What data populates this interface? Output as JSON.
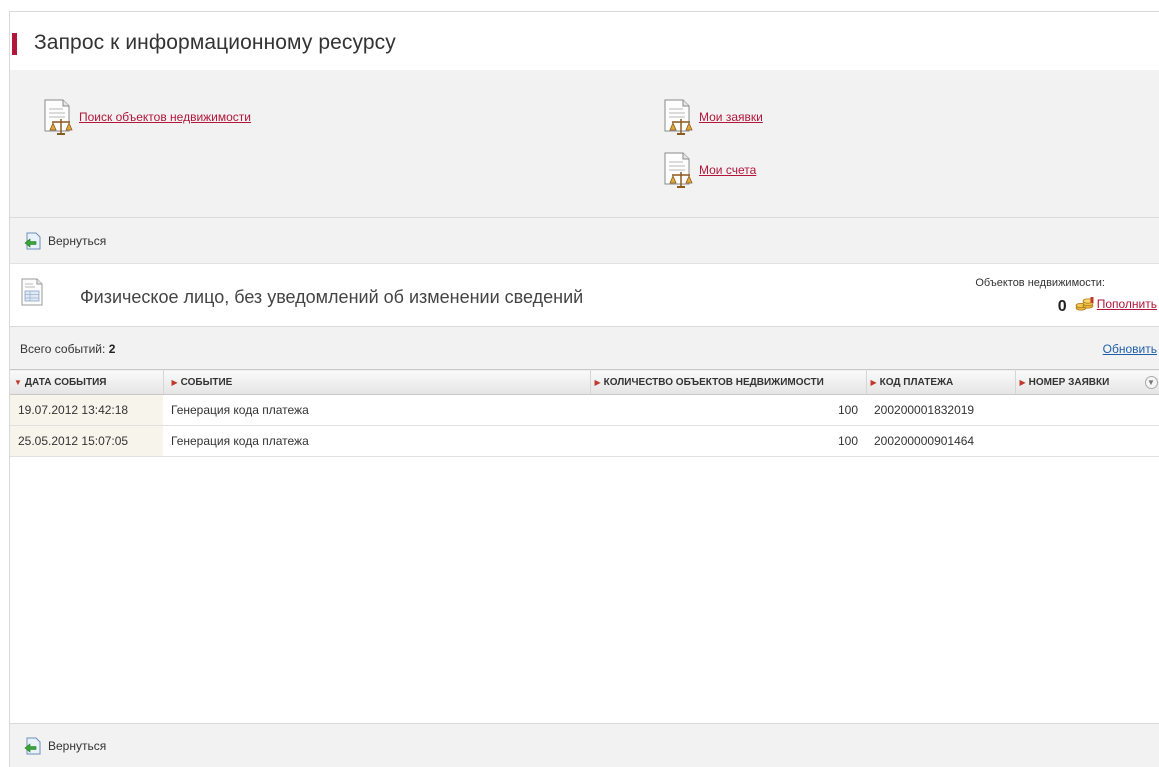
{
  "page": {
    "title": "Запрос к информационному ресурсу",
    "accent_color": "#b2163a",
    "link_color": "#b2163a"
  },
  "links": [
    {
      "label": "Поиск объектов недвижимости",
      "icon": "document-scales-icon"
    },
    {
      "label": "Мои заявки",
      "icon": "document-scales-icon"
    },
    {
      "label": "Мои счета",
      "icon": "document-scales-icon"
    }
  ],
  "toolbar": {
    "back_label": "Вернуться",
    "back_icon": "back-arrow-icon"
  },
  "subject": {
    "title": "Физическое лицо, без уведомлений об изменении сведений",
    "objects_label": "Объектов недвижимости:",
    "objects_count": "0",
    "topup_label": "Пополнить",
    "topup_icon": "coins-icon"
  },
  "summary": {
    "label": "Всего событий:",
    "count": "2",
    "refresh_label": "Обновить",
    "refresh_color": "#1f5fa8"
  },
  "table": {
    "columns": [
      {
        "label": "ДАТА СОБЫТИЯ",
        "sorted": "desc"
      },
      {
        "label": "СОБЫТИЕ",
        "sorted": ""
      },
      {
        "label": "КОЛИЧЕСТВО ОБЪЕКТОВ НЕДВИЖИМОСТИ",
        "sorted": ""
      },
      {
        "label": "КОД ПЛАТЕЖА",
        "sorted": ""
      },
      {
        "label": "НОМЕР ЗАЯВКИ",
        "sorted": ""
      }
    ],
    "rows": [
      {
        "date": "19.07.2012 13:42:18",
        "event": "Генерация кода платежа",
        "count": "100",
        "code": "200200001832019",
        "request": ""
      },
      {
        "date": "25.05.2012 15:07:05",
        "event": "Генерация кода платежа",
        "count": "100",
        "code": "200200000901464",
        "request": ""
      }
    ]
  }
}
